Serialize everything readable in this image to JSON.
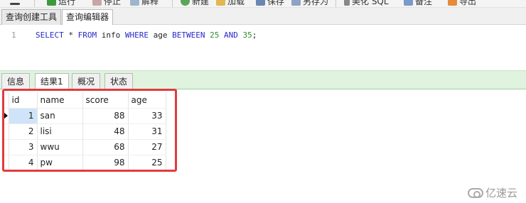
{
  "toolbar": {
    "items": [
      {
        "label": "运行",
        "icon": "play-icon"
      },
      {
        "label": "停止",
        "icon": "stop-icon"
      },
      {
        "label": "解释",
        "icon": "explain-icon"
      },
      {
        "label": "新建",
        "icon": "new-icon"
      },
      {
        "label": "加载",
        "icon": "load-icon"
      },
      {
        "label": "保存",
        "icon": "save-icon"
      },
      {
        "label": "另存为",
        "icon": "save-as-icon"
      },
      {
        "label": "美化 SQL",
        "icon": "beautify-icon"
      },
      {
        "label": "备注",
        "icon": "comment-icon"
      },
      {
        "label": "导出",
        "icon": "export-icon"
      }
    ]
  },
  "editor_tabs": [
    {
      "label": "查询创建工具"
    },
    {
      "label": "查询编辑器"
    }
  ],
  "editor": {
    "line_number": "1",
    "tokens": {
      "select": "SELECT",
      "star": " * ",
      "from": "FROM",
      "table": " info ",
      "where": "WHERE",
      "column": " age ",
      "between": "BETWEEN",
      "low": "25",
      "and": "AND",
      "high": "35",
      "end": ";"
    }
  },
  "result_tabs": [
    {
      "label": "信息"
    },
    {
      "label": "结果1"
    },
    {
      "label": "概况"
    },
    {
      "label": "状态"
    }
  ],
  "grid": {
    "columns": [
      "id",
      "name",
      "score",
      "age"
    ],
    "rows": [
      [
        "1",
        "san",
        "88",
        "33"
      ],
      [
        "2",
        "lisi",
        "48",
        "31"
      ],
      [
        "3",
        "wwu",
        "68",
        "27"
      ],
      [
        "4",
        "pw",
        "98",
        "25"
      ]
    ]
  },
  "watermark": {
    "text": "亿速云"
  },
  "colors": {
    "highlight": "#e03c3c",
    "keyword": "#2a2ac8",
    "number": "#2f8f2f",
    "result_tab_bar": "#dff3df"
  }
}
